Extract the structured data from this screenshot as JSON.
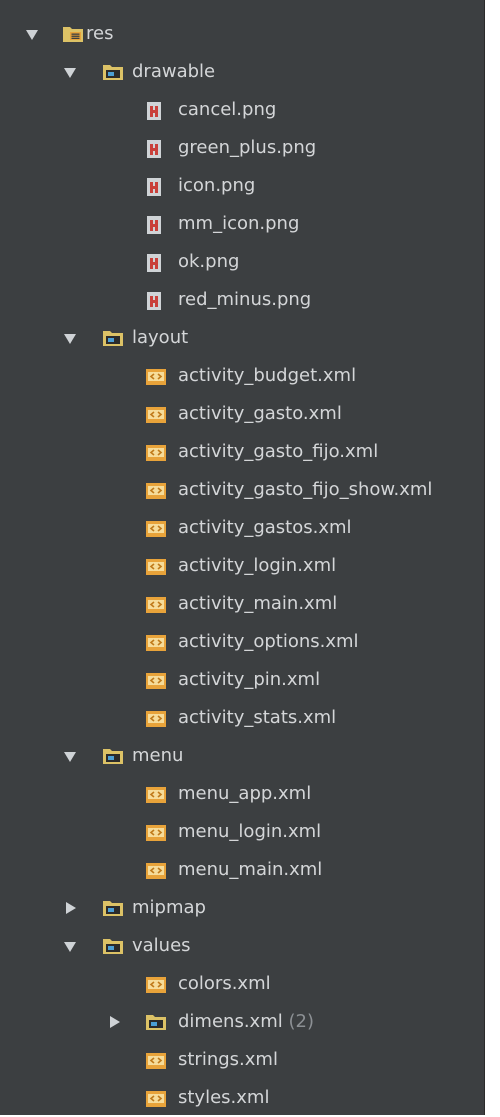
{
  "tree": {
    "root": {
      "label": "res",
      "expanded": true
    },
    "drawable": {
      "label": "drawable",
      "expanded": true,
      "files": [
        "cancel.png",
        "green_plus.png",
        "icon.png",
        "mm_icon.png",
        "ok.png",
        "red_minus.png"
      ]
    },
    "layout": {
      "label": "layout",
      "expanded": true,
      "files": [
        "activity_budget.xml",
        "activity_gasto.xml",
        "activity_gasto_fijo.xml",
        "activity_gasto_fijo_show.xml",
        "activity_gastos.xml",
        "activity_login.xml",
        "activity_main.xml",
        "activity_options.xml",
        "activity_pin.xml",
        "activity_stats.xml"
      ]
    },
    "menu": {
      "label": "menu",
      "expanded": true,
      "files": [
        "menu_app.xml",
        "menu_login.xml",
        "menu_main.xml"
      ]
    },
    "mipmap": {
      "label": "mipmap",
      "expanded": false
    },
    "values": {
      "label": "values",
      "expanded": true,
      "files": {
        "colors": "colors.xml",
        "dimens": {
          "label": "dimens.xml",
          "count": "(2)",
          "expanded": false
        },
        "strings": "strings.xml",
        "styles": "styles.xml"
      }
    }
  },
  "colors": {
    "panel_bg": "#3c3f41",
    "text": "#d4d6d8",
    "muted": "#8c9094",
    "folder": "#dcc266",
    "folder_badge": "#4b9fd5",
    "xml_icon": "#e8a33a",
    "png_icon": "#c9403a"
  }
}
